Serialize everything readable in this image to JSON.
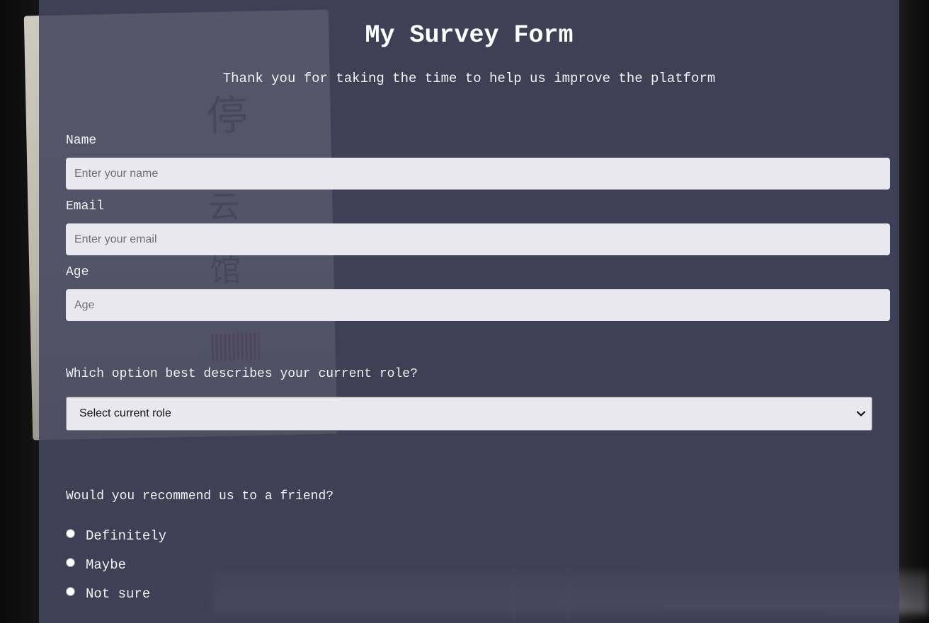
{
  "form": {
    "title": "My Survey Form",
    "description": "Thank you for taking the time to help us improve the platform",
    "name_label": "Name",
    "name_placeholder": "Enter your name",
    "email_label": "Email",
    "email_placeholder": "Enter your email",
    "age_label": "Age",
    "age_placeholder": "Age",
    "role_question": "Which option best describes your current role?",
    "role_selected": "Select current role",
    "recommend_question": "Would you recommend us to a friend?",
    "recommend_options": [
      {
        "label": "Definitely",
        "checked": false
      },
      {
        "label": "Maybe",
        "checked": false
      },
      {
        "label": "Not sure",
        "checked": false
      }
    ]
  },
  "colors": {
    "panel_background": "#44465e",
    "input_background": "#e9e8ee",
    "text": "#f2f2f2"
  }
}
